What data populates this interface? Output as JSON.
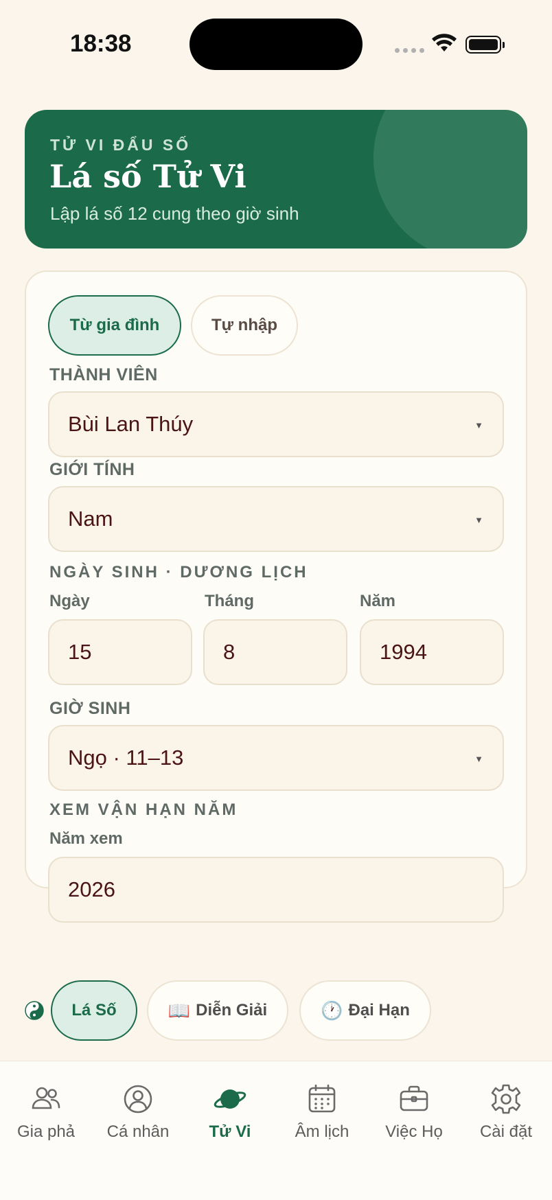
{
  "status_bar": {
    "time": "18:38"
  },
  "hero": {
    "kicker": "TỬ VI ĐẨU SỐ",
    "title": "Lá số Tử Vi",
    "subtitle": "Lập lá số 12 cung theo giờ sinh"
  },
  "source_toggle": {
    "options": [
      {
        "label": "Từ gia đình",
        "active": true
      },
      {
        "label": "Tự nhập",
        "active": false
      }
    ]
  },
  "form": {
    "member": {
      "label": "THÀNH VIÊN",
      "value": "Bùi Lan Thúy"
    },
    "gender": {
      "label": "GIỚI TÍNH",
      "value": "Nam"
    },
    "birth_date": {
      "section": "NGÀY SINH · DƯƠNG LỊCH",
      "day": {
        "label": "Ngày",
        "value": "15"
      },
      "month": {
        "label": "Tháng",
        "value": "8"
      },
      "year": {
        "label": "Năm",
        "value": "1994"
      }
    },
    "birth_hour": {
      "label": "GIỜ SINH",
      "value": "Ngọ · 11–13"
    },
    "fortune_year": {
      "section": "XEM VẬN HẠN NĂM",
      "label": "Năm xem",
      "value": "2026"
    }
  },
  "result_tabs": [
    {
      "label": "Lá Số",
      "icon": "",
      "active": true
    },
    {
      "label": "Diễn Giải",
      "icon": "📖",
      "active": false
    },
    {
      "label": "Đại Hạn",
      "icon": "🕐",
      "active": false
    }
  ],
  "bottom_nav": [
    {
      "label": "Gia phả",
      "icon": "users-icon",
      "active": false
    },
    {
      "label": "Cá nhân",
      "icon": "user-circle-icon",
      "active": false
    },
    {
      "label": "Tử Vi",
      "icon": "planet-icon",
      "active": true
    },
    {
      "label": "Âm lịch",
      "icon": "calendar-icon",
      "active": false
    },
    {
      "label": "Việc Họ",
      "icon": "briefcase-icon",
      "active": false
    },
    {
      "label": "Cài đặt",
      "icon": "gear-icon",
      "active": false
    }
  ],
  "colors": {
    "background": "#fbf5ec",
    "primary_green": "#1b6b4a",
    "active_chip_bg": "#dceee5",
    "input_bg": "#fbf4e9",
    "value_text": "#4a1414"
  }
}
